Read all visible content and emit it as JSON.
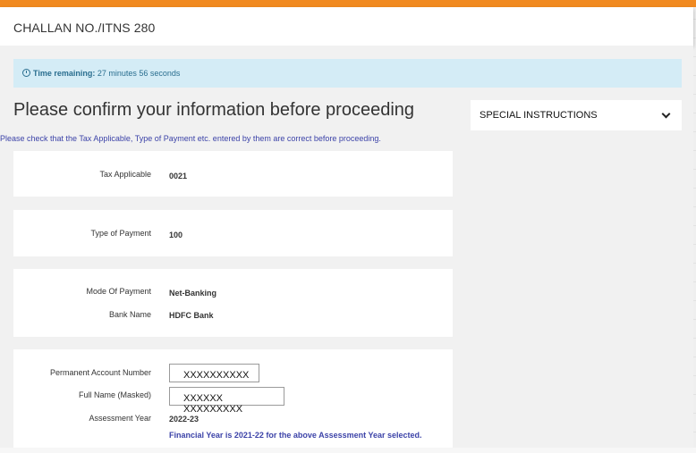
{
  "header": {
    "title": "CHALLAN NO./ITNS 280"
  },
  "alert": {
    "label": "Time remaining:",
    "value": "27 minutes 56 seconds",
    "icon": "clock-icon"
  },
  "page": {
    "title": "Please confirm your information before proceeding",
    "note": "Please check that the Tax Applicable, Type of Payment etc. entered by them are correct before proceeding."
  },
  "tax": {
    "label": "Tax Applicable",
    "value": "0021"
  },
  "payment_type": {
    "label": "Type of Payment",
    "value": "100"
  },
  "mode": {
    "label": "Mode Of Payment",
    "value": "Net-Banking"
  },
  "bank": {
    "label": "Bank Name",
    "value": "HDFC Bank"
  },
  "pan": {
    "label": "Permanent Account Number",
    "value": "XXXXXXXXXX"
  },
  "name": {
    "label": "Full Name (Masked)",
    "value": "XXXXXX XXXXXXXXX"
  },
  "ay": {
    "label": "Assessment Year",
    "value": "2022-23"
  },
  "fy_note": "Financial Year is 2021-22 for the above Assessment Year selected.",
  "special": {
    "label": "SPECIAL INSTRUCTIONS",
    "icon": "chevron-down-icon"
  },
  "colors": {
    "accent": "#f18a21",
    "alert_bg": "#d4ecf6",
    "link": "#3c43a8"
  }
}
